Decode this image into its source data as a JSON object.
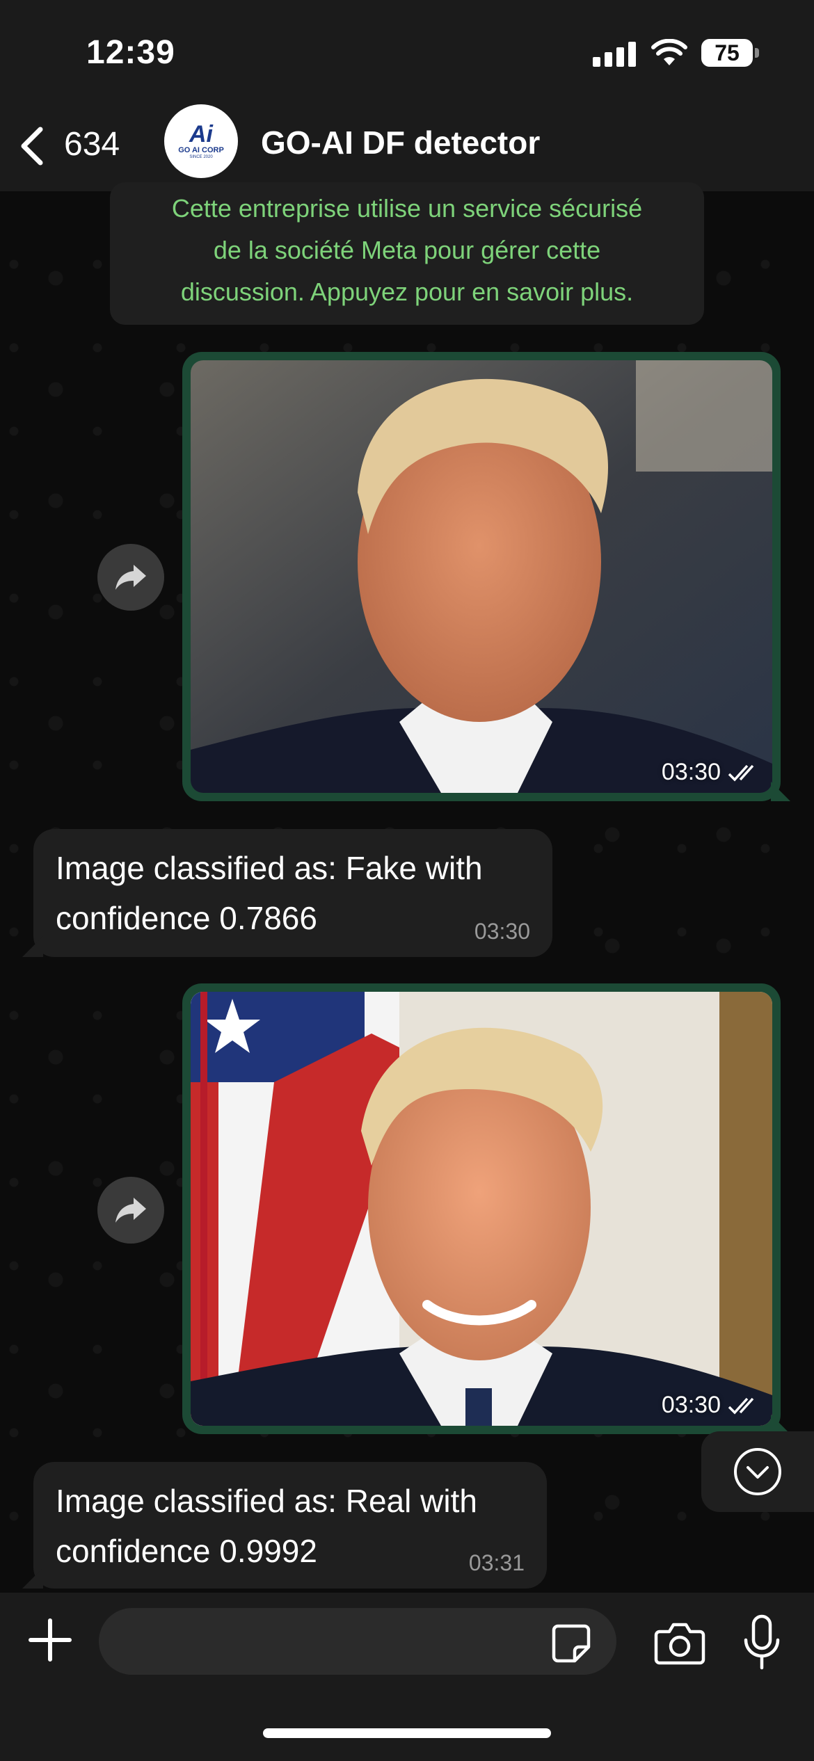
{
  "status_bar": {
    "time": "12:39",
    "battery": "75"
  },
  "header": {
    "back_count": "634",
    "chat_title": "GO-AI DF detector",
    "avatar_logo": "Ai",
    "avatar_text": "GO AI CORP",
    "avatar_sub": "SINCE 2020"
  },
  "system_notice": "Cette entreprise utilise un service sécurisé\nde la société Meta pour gérer cette\ndiscussion. Appuyez pour en savoir plus.",
  "messages": [
    {
      "type": "image",
      "time": "03:30",
      "status": "read",
      "image_desc": "portrait, serious expression"
    },
    {
      "type": "text",
      "text": "Image classified as: Fake with\nconfidence 0.7866",
      "time": "03:30"
    },
    {
      "type": "image",
      "time": "03:30",
      "status": "read",
      "image_desc": "portrait, smiling, flag background"
    },
    {
      "type": "text",
      "text": "Image classified as: Real with\nconfidence 0.9992",
      "time": "03:31"
    }
  ],
  "composer": {
    "placeholder": ""
  },
  "colors": {
    "notice_text": "#7ed37a",
    "outgoing_bubble": "#1c4a35",
    "incoming_bubble": "#1f1f1f"
  },
  "icons": [
    "back-chevron-icon",
    "forward-icon",
    "double-check-icon",
    "chevron-down-icon",
    "plus-icon",
    "sticker-icon",
    "camera-icon",
    "mic-icon"
  ]
}
